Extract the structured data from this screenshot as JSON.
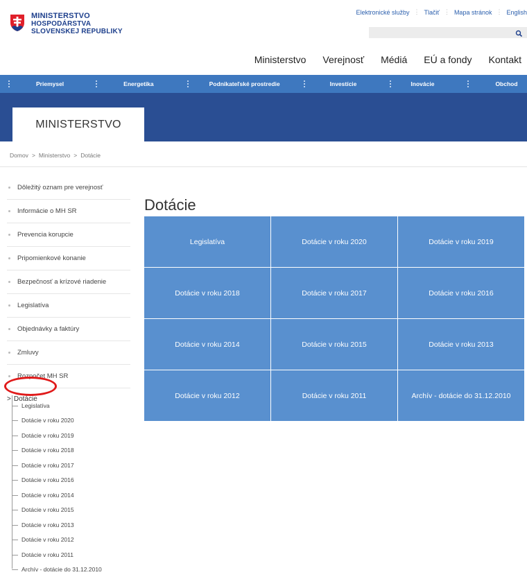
{
  "header": {
    "logo": {
      "line1": "MINISTERSTVO",
      "line2": "HOSPODÁRSTVA",
      "line3": "SLOVENSKEJ REPUBLIKY"
    },
    "toplinks": [
      "Elektronické služby",
      "Tlačiť",
      "Mapa stránok",
      "English"
    ],
    "search": {
      "placeholder": ""
    },
    "mainnav": [
      "Ministerstvo",
      "Verejnosť",
      "Médiá",
      "EÚ a fondy",
      "Kontakt"
    ]
  },
  "subnav": [
    "Priemysel",
    "Energetika",
    "Podnikateľské prostredie",
    "Investície",
    "Inovácie",
    "Obchod"
  ],
  "banner": {
    "title": "MINISTERSTVO"
  },
  "breadcrumb": {
    "items": [
      "Domov",
      "Ministerstvo",
      "Dotácie"
    ],
    "separator": ">"
  },
  "sidebar": {
    "items": [
      "Dôležitý oznam pre verejnosť",
      "Informácie o MH SR",
      "Prevencia korupcie",
      "Pripomienkové konanie",
      "Bezpečnosť a krízové riadenie",
      "Legislatíva",
      "Objednávky a faktúry",
      "Zmluvy",
      "Rozpočet MH SR"
    ],
    "active": {
      "chevron": ">",
      "label": "Dotácie"
    },
    "subitems": [
      "Legislatíva",
      "Dotácie v roku 2020",
      "Dotácie v roku 2019",
      "Dotácie v roku 2018",
      "Dotácie v roku 2017",
      "Dotácie v roku 2016",
      "Dotácie v roku 2014",
      "Dotácie v roku 2015",
      "Dotácie v roku 2013",
      "Dotácie v roku 2012",
      "Dotácie v roku 2011",
      "Archív - dotácie do 31.12.2010"
    ]
  },
  "content": {
    "title": "Dotácie",
    "tiles": [
      "Legislatíva",
      "Dotácie v roku 2020",
      "Dotácie v roku 2019",
      "Dotácie v roku 2018",
      "Dotácie v roku 2017",
      "Dotácie v roku 2016",
      "Dotácie v roku 2014",
      "Dotácie v roku 2015",
      "Dotácie v roku 2013",
      "Dotácie v roku 2012",
      "Dotácie v roku 2011",
      "Archív - dotácie do 31.12.2010"
    ]
  },
  "icons": {
    "logo": "slovak-crest-icon",
    "search": "search-icon",
    "nav_separator": "dots-separator-icon",
    "highlight": "red-ellipse-annotation"
  },
  "colors": {
    "brand_blue": "#1d3f8c",
    "subnav_blue": "#3e78bf",
    "banner_blue": "#2a4e93",
    "tile_blue": "#5990cf",
    "annotation_red": "#e01a1a"
  }
}
